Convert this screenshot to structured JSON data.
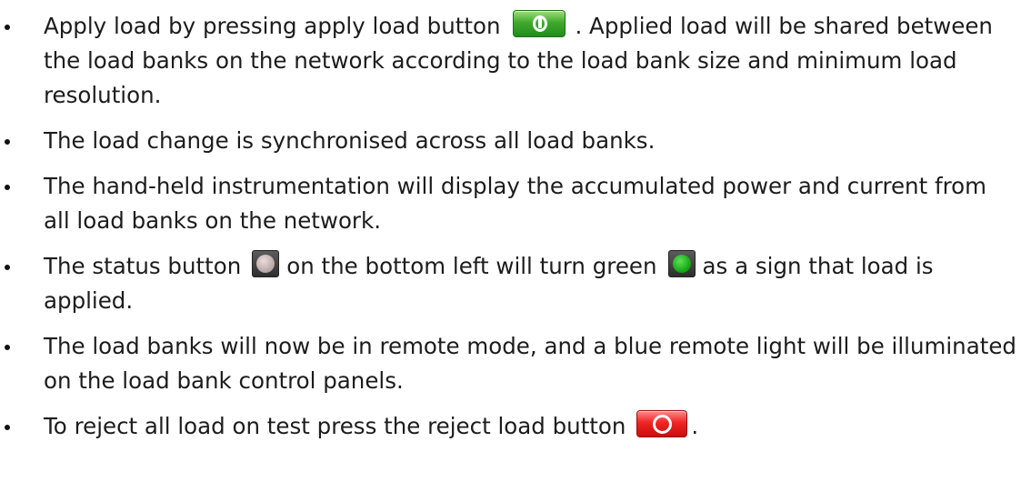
{
  "items": [
    {
      "before": "Apply load by pressing apply load button",
      "after": ". Applied load will be shared between the load banks on the network according to the load bank size and minimum load resolution."
    },
    {
      "text": "The load change is synchronised across all load banks."
    },
    {
      "text": "The hand-held instrumentation will display the accumulated power and current from all load banks on the network."
    },
    {
      "before": "The status button",
      "middle": "on the bottom left will turn green",
      "after": "as a sign that load is applied."
    },
    {
      "text": "The load banks will now be in remote mode, and a blue remote light will be illuminated on the load bank control panels."
    },
    {
      "before": "To reject all load on test press the reject load button",
      "after": "."
    }
  ],
  "icons": {
    "apply_button": "apply-load-icon",
    "status_off": "status-grey-icon",
    "status_on": "status-green-icon",
    "reject_button": "reject-load-icon"
  },
  "colors": {
    "apply": "#3faa2d",
    "status_off": "#b7a4a4",
    "status_on": "#14a812",
    "reject": "#f02424"
  }
}
